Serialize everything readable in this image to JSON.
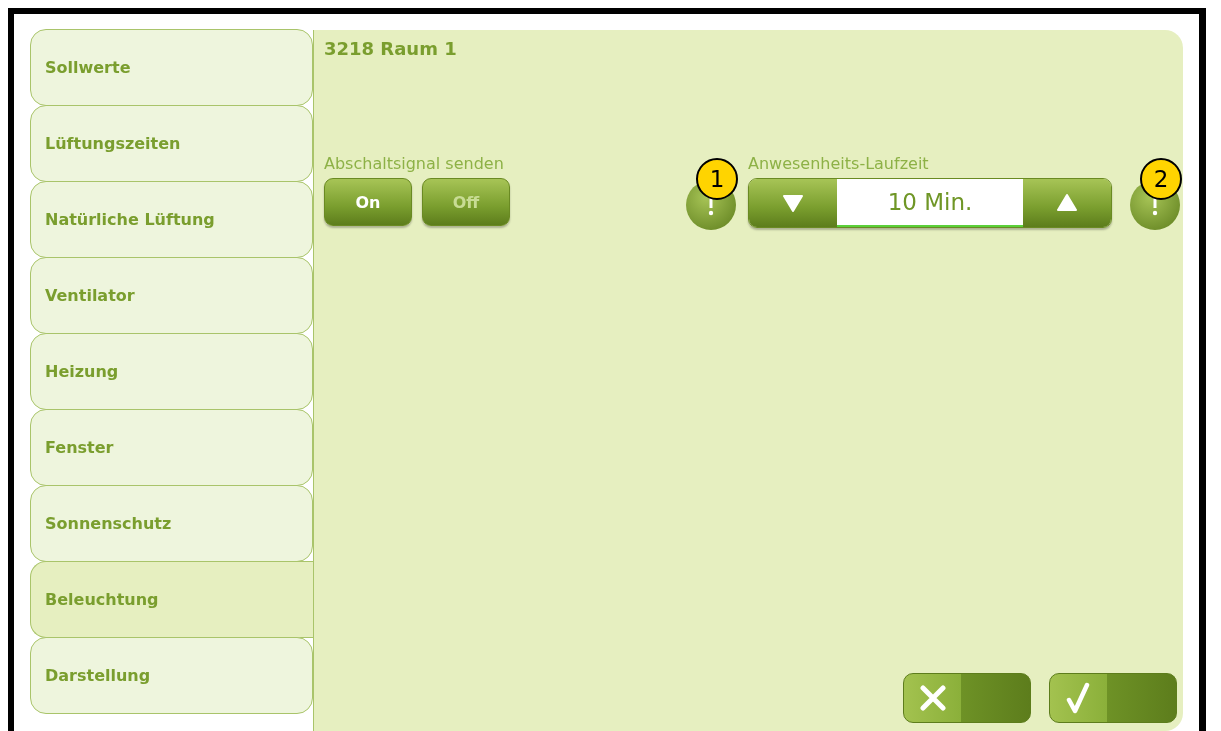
{
  "tabs": [
    {
      "label": "Sollwerte",
      "selected": false
    },
    {
      "label": "Lüftungszeiten",
      "selected": false
    },
    {
      "label": "Natürliche Lüftung",
      "selected": false
    },
    {
      "label": "Ventilator",
      "selected": false
    },
    {
      "label": "Heizung",
      "selected": false
    },
    {
      "label": "Fenster",
      "selected": false
    },
    {
      "label": "Sonnenschutz",
      "selected": false
    },
    {
      "label": "Beleuchtung",
      "selected": true
    },
    {
      "label": "Darstellung",
      "selected": false
    }
  ],
  "title": "3218 Raum 1",
  "switch": {
    "label": "Abschaltsignal senden",
    "options": [
      {
        "label": "On",
        "selected": true
      },
      {
        "label": "Off",
        "selected": false
      }
    ]
  },
  "stepper": {
    "label": "Anwesenheits-Laufzeit",
    "value": "10 Min."
  },
  "callouts": [
    "1",
    "2"
  ]
}
